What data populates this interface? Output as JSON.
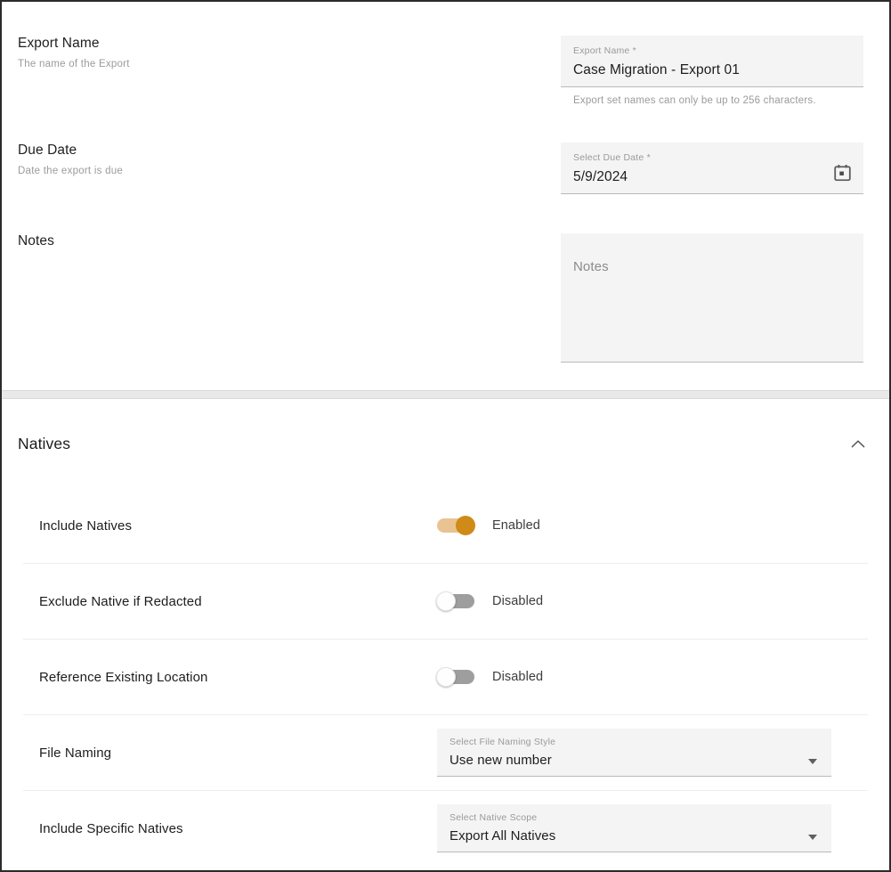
{
  "top_section": {
    "rows": [
      {
        "title": "Export Name",
        "description": "The name of the Export",
        "field": {
          "type": "text",
          "label": "Export Name *",
          "value": "Case Migration - Export 01",
          "helper": "Export set names can only be up to 256 characters."
        }
      },
      {
        "title": "Due Date",
        "description": "Date the export is due",
        "field": {
          "type": "date",
          "label": "Select Due Date *",
          "value": "5/9/2024",
          "icon": "calendar-icon"
        }
      },
      {
        "title": "Notes",
        "description": "",
        "field": {
          "type": "textarea",
          "placeholder": "Notes",
          "value": ""
        }
      }
    ]
  },
  "natives_section": {
    "title": "Natives",
    "collapse_icon": "chevron-up-icon",
    "rows": [
      {
        "label": "Include Natives",
        "control": "toggle",
        "state": "on",
        "state_text": "Enabled"
      },
      {
        "label": "Exclude Native if Redacted",
        "control": "toggle",
        "state": "off",
        "state_text": "Disabled"
      },
      {
        "label": "Reference Existing Location",
        "control": "toggle",
        "state": "off",
        "state_text": "Disabled"
      },
      {
        "label": "File Naming",
        "control": "select",
        "select_label": "Select File Naming Style",
        "select_value": "Use new number"
      },
      {
        "label": "Include Specific Natives",
        "control": "select",
        "select_label": "Select Native Scope",
        "select_value": "Export All Natives"
      }
    ]
  },
  "colors": {
    "accent_on_track": "#e9c391",
    "accent_on_thumb": "#cf8a18",
    "off_track": "#9e9e9e",
    "field_bg": "#f4f4f4",
    "page_border": "#2b2b2b"
  }
}
